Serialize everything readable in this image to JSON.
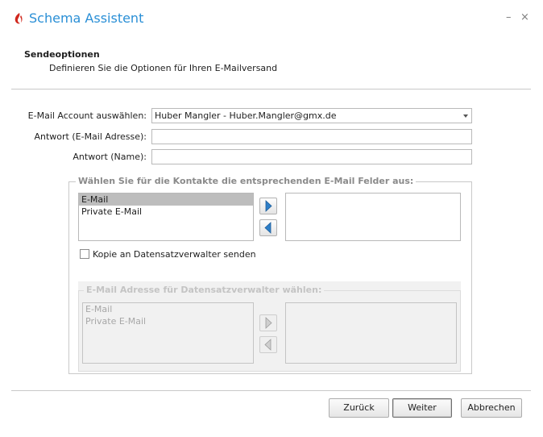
{
  "window": {
    "title": "Schema Assistent",
    "minimize_glyph": "–",
    "close_glyph": "×"
  },
  "section": {
    "title": "Sendeoptionen",
    "subtitle": "Definieren Sie die Optionen für Ihren E-Mailversand"
  },
  "form": {
    "account_label": "E-Mail Account auswählen:",
    "account_value": "Huber Mangler - Huber.Mangler@gmx.de",
    "reply_email_label": "Antwort (E-Mail Adresse):",
    "reply_email_value": "",
    "reply_name_label": "Antwort (Name):",
    "reply_name_value": ""
  },
  "contacts_group": {
    "legend": "Wählen Sie für die Kontakte die entsprechenden E-Mail Felder aus:",
    "available": [
      "E-Mail",
      "Private E-Mail"
    ],
    "selected_index": 0,
    "chosen": []
  },
  "copy_checkbox": {
    "label": "Kopie an Datensatzverwalter senden",
    "checked": false
  },
  "manager_group": {
    "legend": "E-Mail Adresse für Datensatzverwalter wählen:",
    "available": [
      "E-Mail",
      "Private E-Mail"
    ],
    "chosen": [],
    "enabled": false
  },
  "buttons": {
    "back": "Zurück",
    "next": "Weiter",
    "cancel": "Abbrechen"
  },
  "colors": {
    "title_blue": "#2a8fd6",
    "logo_red": "#d0281e",
    "arrow_blue": "#2e7fc8"
  },
  "icons": {
    "logo": "flame-logo-icon",
    "move_right": "arrow-right-icon",
    "move_left": "arrow-left-icon"
  }
}
